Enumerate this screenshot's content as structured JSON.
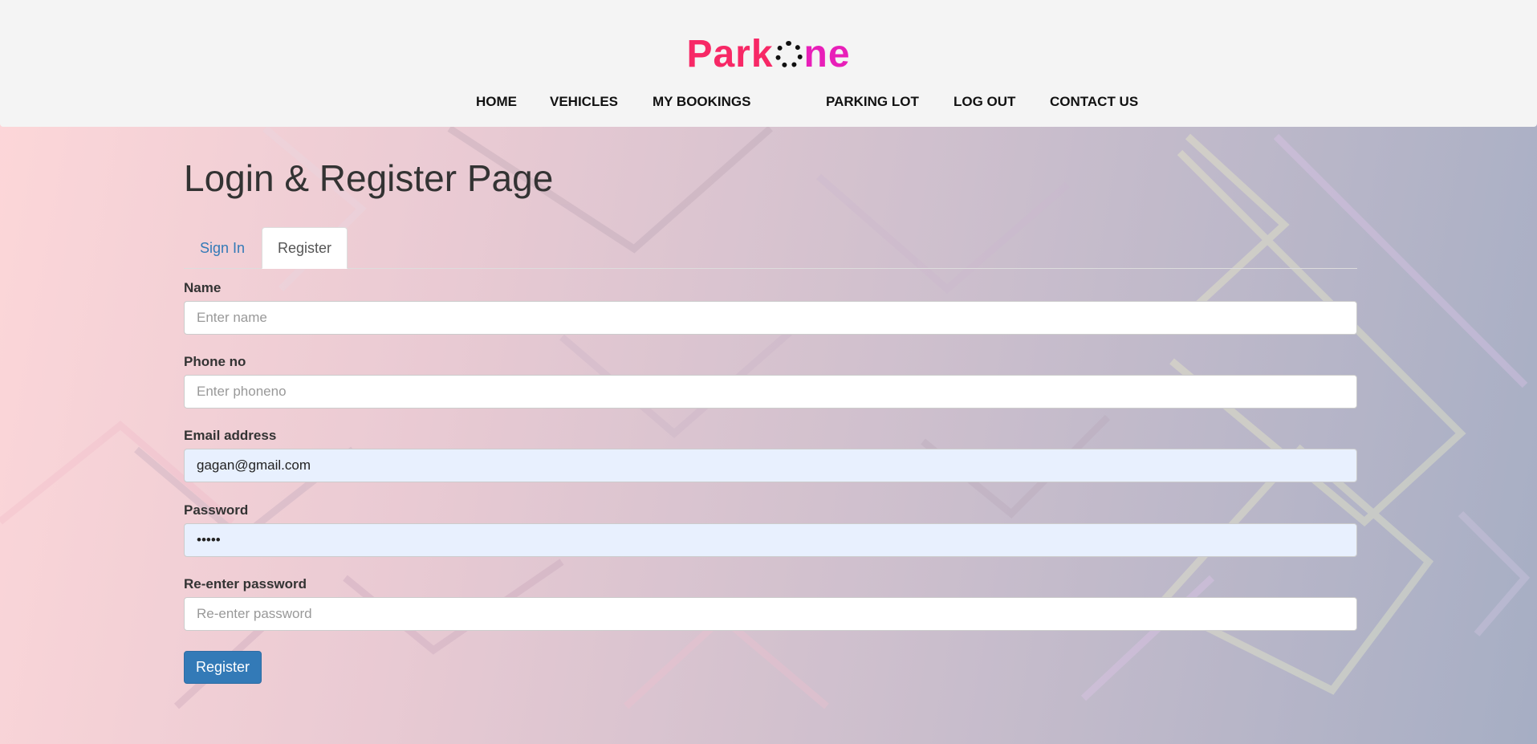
{
  "brand": {
    "part1": "Park",
    "part2": "ne"
  },
  "nav": {
    "items": [
      "HOME",
      "VEHICLES",
      "MY BOOKINGS",
      "PARKING LOT",
      "LOG OUT",
      "CONTACT US"
    ]
  },
  "page_title": "Login & Register Page",
  "tabs": [
    {
      "label": "Sign In",
      "active": false
    },
    {
      "label": "Register",
      "active": true
    }
  ],
  "form": {
    "name": {
      "label": "Name",
      "placeholder": "Enter name",
      "value": ""
    },
    "phone": {
      "label": "Phone no",
      "placeholder": "Enter phoneno",
      "value": ""
    },
    "email": {
      "label": "Email address",
      "placeholder": "",
      "value": "gagan@gmail.com"
    },
    "password": {
      "label": "Password",
      "placeholder": "",
      "value": "•••••"
    },
    "repassword": {
      "label": "Re-enter password",
      "placeholder": "Re-enter password",
      "value": ""
    },
    "submit_label": "Register"
  },
  "colors": {
    "brand_red": "#f72866",
    "brand_pink": "#e81fb9",
    "link_blue": "#337ab7",
    "autofill_bg": "#e8f0fe"
  }
}
